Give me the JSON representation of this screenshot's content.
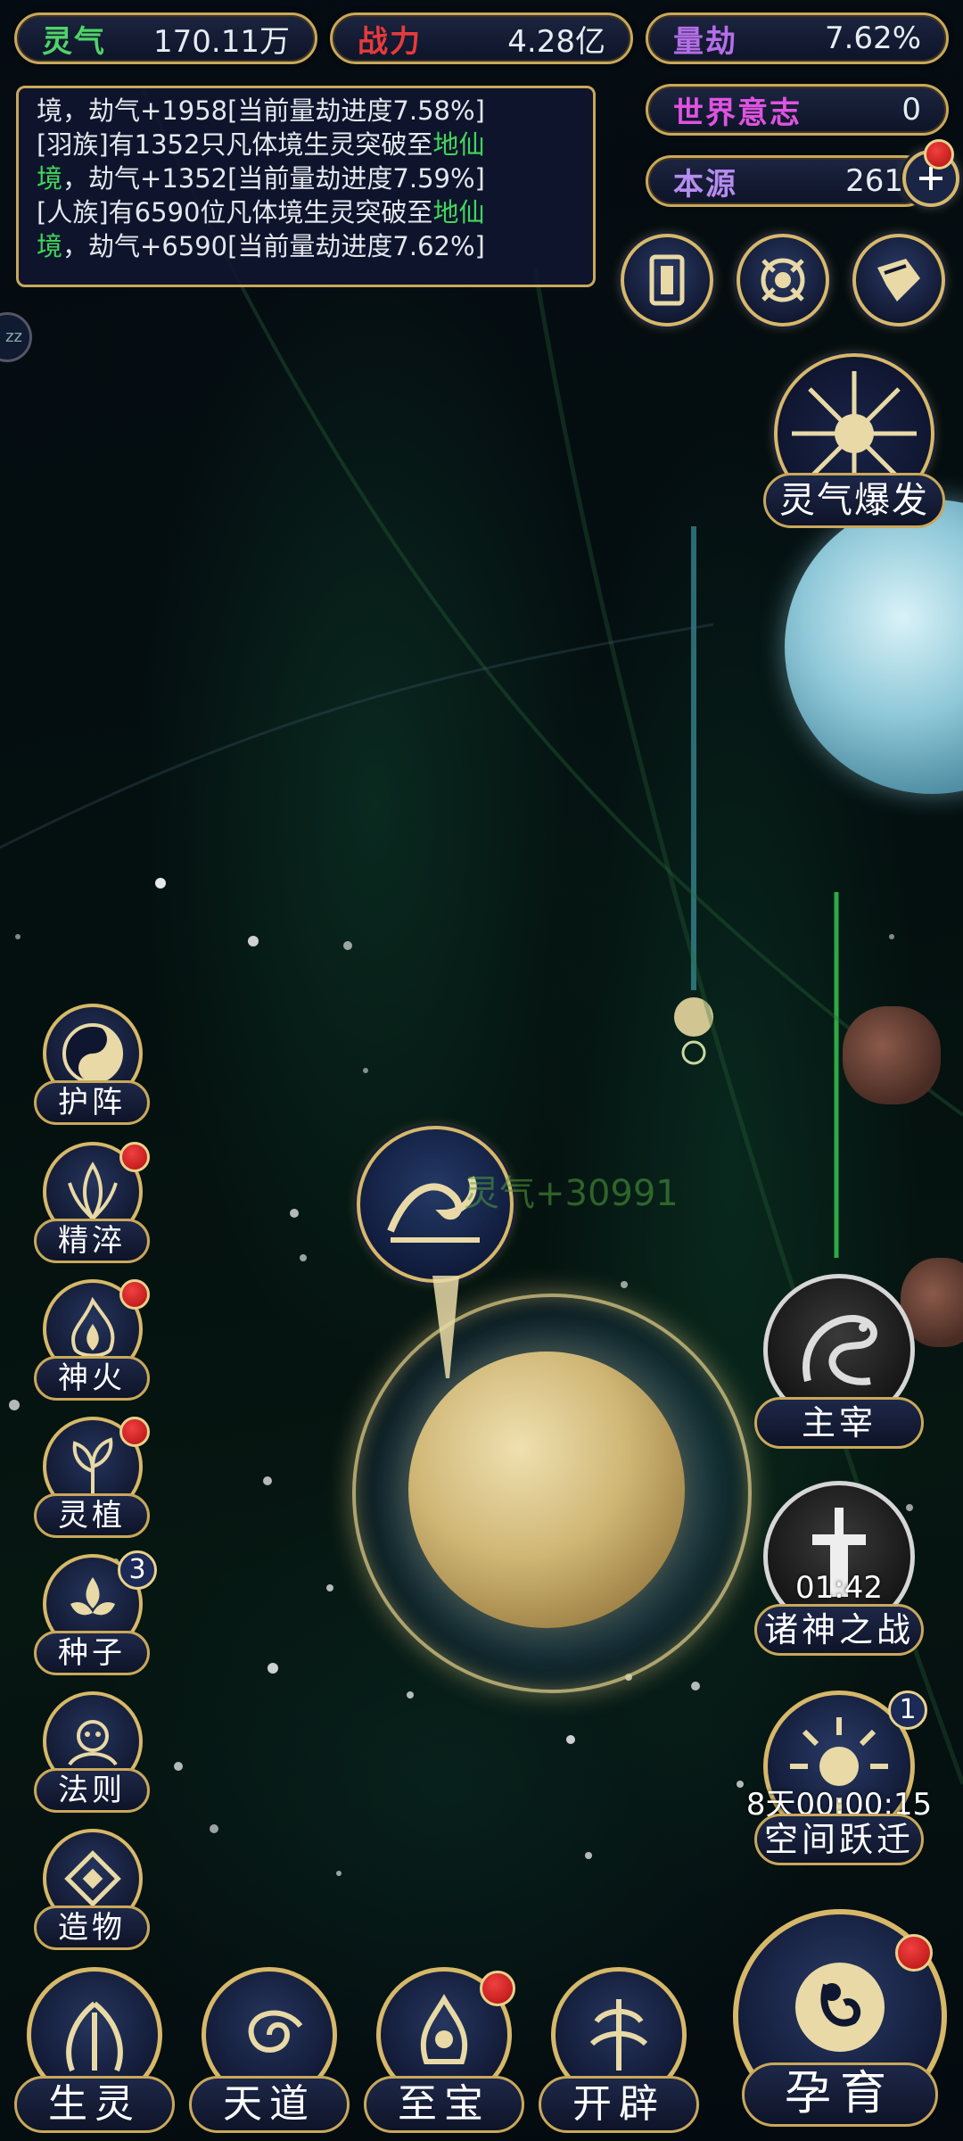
{
  "resources": {
    "lingqi": {
      "label": "灵气",
      "value": "170.11万"
    },
    "zhanli": {
      "label": "战力",
      "value": "4.28亿"
    },
    "liangjie": {
      "label": "量劫",
      "value": "7.62%"
    },
    "shijie": {
      "label": "世界意志",
      "value": "0"
    },
    "benyuan": {
      "label": "本源",
      "value": "261"
    }
  },
  "log": {
    "line1_a": "境，劫气+1958[当前量劫进度7.58%]",
    "line2_a": "[羽族]有1352只凡体境生灵突破至",
    "line2_hl": "地仙",
    "line3_hl": "境",
    "line3_b": "，劫气+1352[当前量劫进度7.59%]",
    "line4_a": "[人族]有6590位凡体境生灵突破至",
    "line4_hl": "地仙",
    "line5_hl": "境",
    "line5_b": "，劫气+6590[当前量劫进度7.62%]"
  },
  "left_menu": [
    {
      "label": "护阵",
      "icon": "yin-yang-icon"
    },
    {
      "label": "精淬",
      "icon": "flower-icon"
    },
    {
      "label": "神火",
      "icon": "flame-icon"
    },
    {
      "label": "灵植",
      "icon": "plant-icon"
    },
    {
      "label": "种子",
      "icon": "seed-icon",
      "badge": "3"
    },
    {
      "label": "法则",
      "icon": "rune-icon"
    },
    {
      "label": "造物",
      "icon": "creation-icon"
    }
  ],
  "right_top": {
    "burst_label": "灵气爆发"
  },
  "right_menu": {
    "master_label": "主宰",
    "war_label": "诸神之战",
    "war_timer": "01:42",
    "jump_label": "空间跃迁",
    "jump_timer": "8天00:00:15",
    "jump_badge": "1"
  },
  "bottom_nav": {
    "n1": "生灵",
    "n2": "天道",
    "n3": "至宝",
    "n4": "开辟",
    "main": "孕育"
  },
  "floating": {
    "lingqi_gain": "灵气+30991",
    "side_letters": "zz"
  },
  "colors": {
    "gold": "#c9a85a",
    "panel": "#101630",
    "highlight_green": "#41d65a",
    "badge_red": "#d02020"
  }
}
